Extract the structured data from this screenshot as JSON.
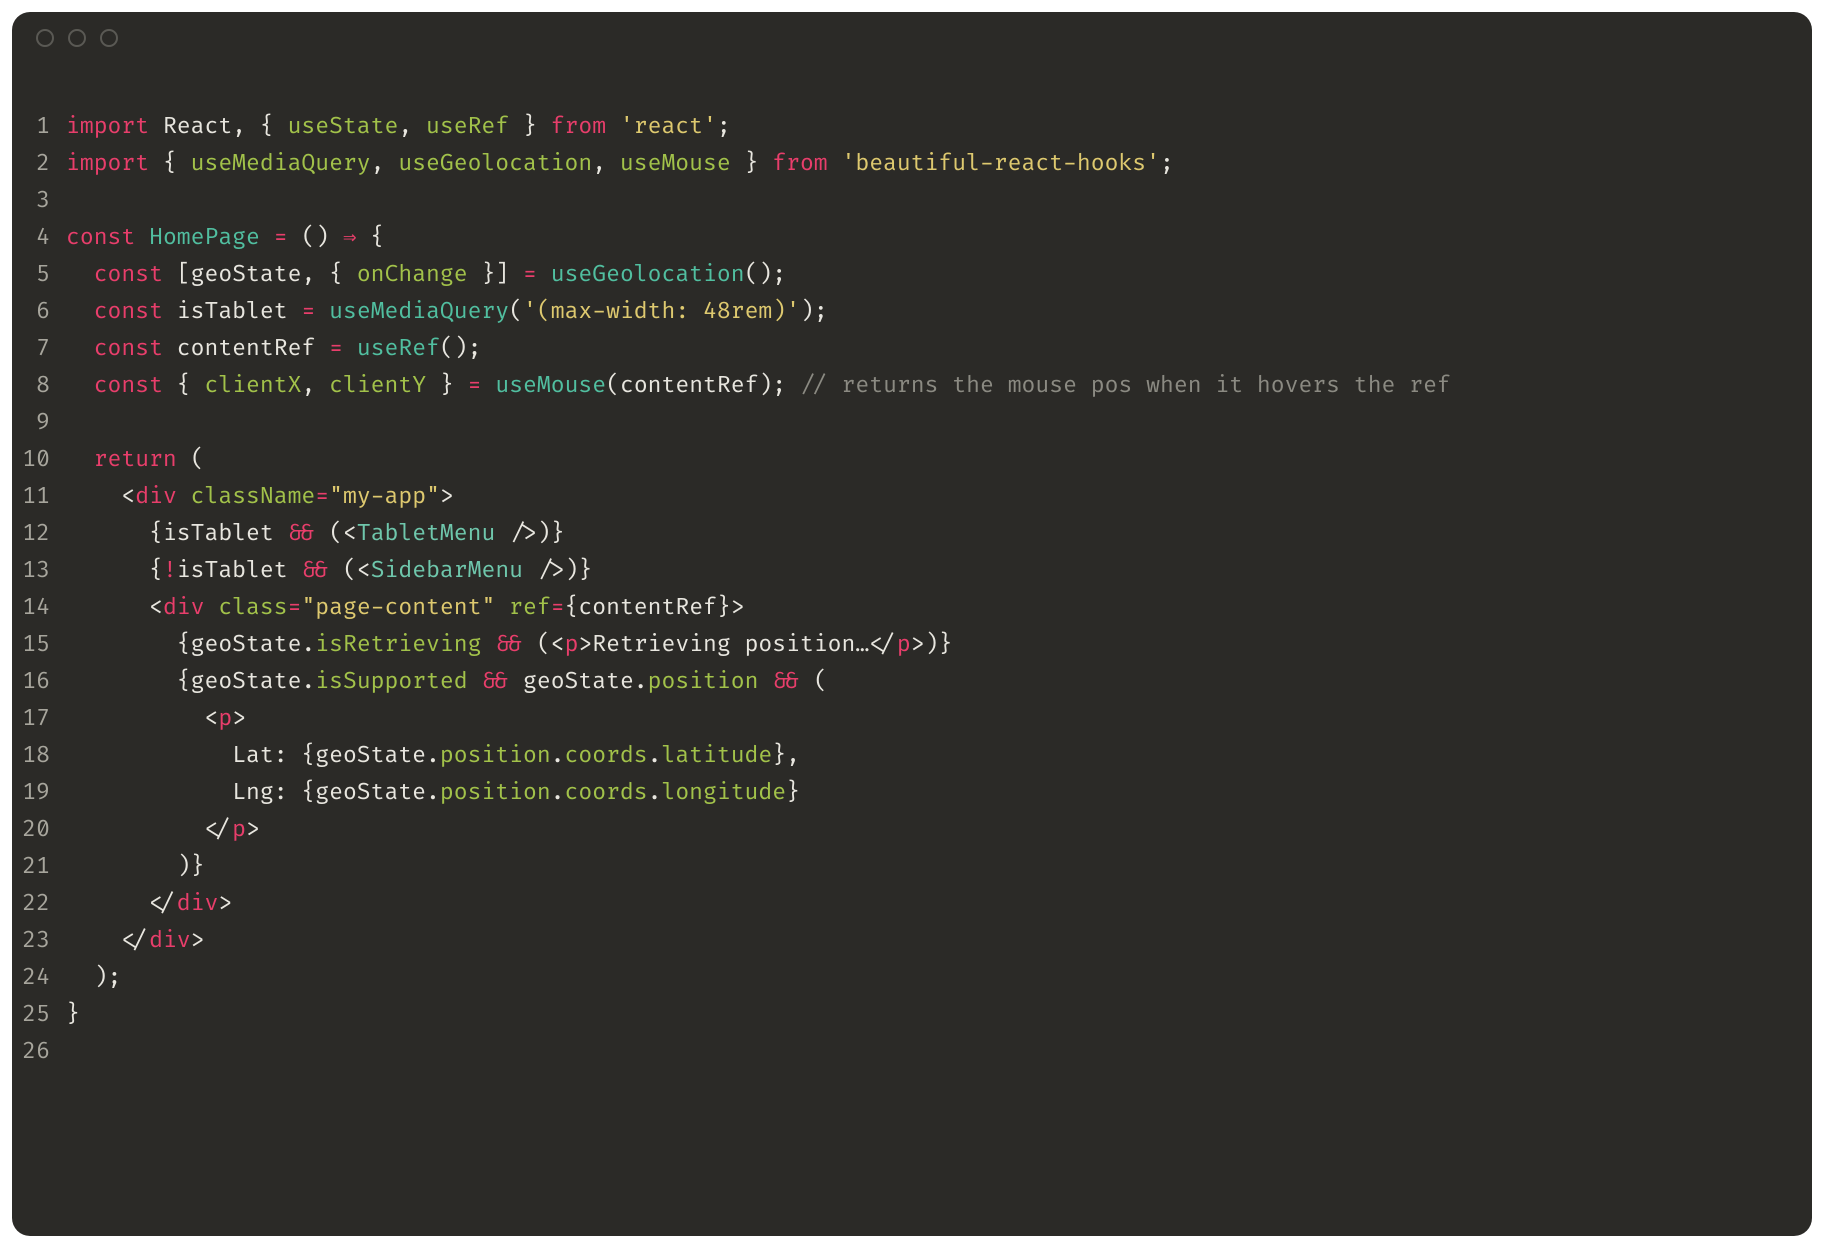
{
  "code": {
    "lines": [
      {
        "n": "1",
        "tokens": [
          {
            "c": "tk-kw",
            "t": "import"
          },
          {
            "t": " "
          },
          {
            "c": "tk-def",
            "t": "React"
          },
          {
            "c": "tk-punc",
            "t": ", { "
          },
          {
            "c": "tk-attr",
            "t": "useState"
          },
          {
            "c": "tk-punc",
            "t": ", "
          },
          {
            "c": "tk-attr",
            "t": "useRef"
          },
          {
            "c": "tk-punc",
            "t": " } "
          },
          {
            "c": "tk-kw",
            "t": "from"
          },
          {
            "t": " "
          },
          {
            "c": "tk-str",
            "t": "'react'"
          },
          {
            "c": "tk-punc",
            "t": ";"
          }
        ]
      },
      {
        "n": "2",
        "tokens": [
          {
            "c": "tk-kw",
            "t": "import"
          },
          {
            "t": " "
          },
          {
            "c": "tk-punc",
            "t": "{ "
          },
          {
            "c": "tk-attr",
            "t": "useMediaQuery"
          },
          {
            "c": "tk-punc",
            "t": ", "
          },
          {
            "c": "tk-attr",
            "t": "useGeolocation"
          },
          {
            "c": "tk-punc",
            "t": ", "
          },
          {
            "c": "tk-attr",
            "t": "useMouse"
          },
          {
            "c": "tk-punc",
            "t": " } "
          },
          {
            "c": "tk-kw",
            "t": "from"
          },
          {
            "t": " "
          },
          {
            "c": "tk-str",
            "t": "'beautiful-react-hooks'"
          },
          {
            "c": "tk-punc",
            "t": ";"
          }
        ]
      },
      {
        "n": "3",
        "tokens": []
      },
      {
        "n": "4",
        "tokens": [
          {
            "c": "tk-kw",
            "t": "const"
          },
          {
            "t": " "
          },
          {
            "c": "tk-fn",
            "t": "HomePage"
          },
          {
            "t": " "
          },
          {
            "c": "tk-kw",
            "t": "="
          },
          {
            "t": " "
          },
          {
            "c": "tk-punc",
            "t": "() "
          },
          {
            "c": "tk-kw",
            "t": "⇒"
          },
          {
            "t": " "
          },
          {
            "c": "tk-punc",
            "t": "{"
          }
        ]
      },
      {
        "n": "5",
        "tokens": [
          {
            "t": "  "
          },
          {
            "c": "tk-kw",
            "t": "const"
          },
          {
            "t": " "
          },
          {
            "c": "tk-punc",
            "t": "["
          },
          {
            "c": "tk-def",
            "t": "geoState"
          },
          {
            "c": "tk-punc",
            "t": ", { "
          },
          {
            "c": "tk-attr",
            "t": "onChange"
          },
          {
            "c": "tk-punc",
            "t": " }] "
          },
          {
            "c": "tk-kw",
            "t": "="
          },
          {
            "t": " "
          },
          {
            "c": "tk-fn",
            "t": "useGeolocation"
          },
          {
            "c": "tk-punc",
            "t": "();"
          }
        ]
      },
      {
        "n": "6",
        "tokens": [
          {
            "t": "  "
          },
          {
            "c": "tk-kw",
            "t": "const"
          },
          {
            "t": " "
          },
          {
            "c": "tk-def",
            "t": "isTablet"
          },
          {
            "t": " "
          },
          {
            "c": "tk-kw",
            "t": "="
          },
          {
            "t": " "
          },
          {
            "c": "tk-fn",
            "t": "useMediaQuery"
          },
          {
            "c": "tk-punc",
            "t": "("
          },
          {
            "c": "tk-str",
            "t": "'(max-width: 48rem)'"
          },
          {
            "c": "tk-punc",
            "t": ");"
          }
        ]
      },
      {
        "n": "7",
        "tokens": [
          {
            "t": "  "
          },
          {
            "c": "tk-kw",
            "t": "const"
          },
          {
            "t": " "
          },
          {
            "c": "tk-def",
            "t": "contentRef"
          },
          {
            "t": " "
          },
          {
            "c": "tk-kw",
            "t": "="
          },
          {
            "t": " "
          },
          {
            "c": "tk-fn",
            "t": "useRef"
          },
          {
            "c": "tk-punc",
            "t": "();"
          }
        ]
      },
      {
        "n": "8",
        "tokens": [
          {
            "t": "  "
          },
          {
            "c": "tk-kw",
            "t": "const"
          },
          {
            "t": " "
          },
          {
            "c": "tk-punc",
            "t": "{ "
          },
          {
            "c": "tk-attr",
            "t": "clientX"
          },
          {
            "c": "tk-punc",
            "t": ", "
          },
          {
            "c": "tk-attr",
            "t": "clientY"
          },
          {
            "c": "tk-punc",
            "t": " } "
          },
          {
            "c": "tk-kw",
            "t": "="
          },
          {
            "t": " "
          },
          {
            "c": "tk-fn",
            "t": "useMouse"
          },
          {
            "c": "tk-punc",
            "t": "("
          },
          {
            "c": "tk-def",
            "t": "contentRef"
          },
          {
            "c": "tk-punc",
            "t": "); "
          },
          {
            "c": "tk-cmt",
            "t": "// returns the mouse pos when it hovers the ref"
          }
        ]
      },
      {
        "n": "9",
        "tokens": []
      },
      {
        "n": "10",
        "tokens": [
          {
            "t": "  "
          },
          {
            "c": "tk-kw",
            "t": "return"
          },
          {
            "t": " "
          },
          {
            "c": "tk-punc",
            "t": "("
          }
        ]
      },
      {
        "n": "11",
        "tokens": [
          {
            "t": "    "
          },
          {
            "c": "tk-punc",
            "t": "<"
          },
          {
            "c": "tk-tag",
            "t": "div"
          },
          {
            "t": " "
          },
          {
            "c": "tk-attr",
            "t": "className"
          },
          {
            "c": "tk-kw",
            "t": "="
          },
          {
            "c": "tk-str",
            "t": "\"my-app\""
          },
          {
            "c": "tk-punc",
            "t": ">"
          }
        ]
      },
      {
        "n": "12",
        "tokens": [
          {
            "t": "      "
          },
          {
            "c": "tk-punc",
            "t": "{"
          },
          {
            "c": "tk-def",
            "t": "isTablet"
          },
          {
            "t": " "
          },
          {
            "c": "tk-kw",
            "t": "&&"
          },
          {
            "t": " "
          },
          {
            "c": "tk-punc",
            "t": "(<"
          },
          {
            "c": "tk-comp",
            "t": "TabletMenu"
          },
          {
            "t": " "
          },
          {
            "c": "tk-punc",
            "t": "/>"
          },
          {
            "c": "tk-punc",
            "t": ")}"
          }
        ]
      },
      {
        "n": "13",
        "tokens": [
          {
            "t": "      "
          },
          {
            "c": "tk-punc",
            "t": "{"
          },
          {
            "c": "tk-kw",
            "t": "!"
          },
          {
            "c": "tk-def",
            "t": "isTablet"
          },
          {
            "t": " "
          },
          {
            "c": "tk-kw",
            "t": "&&"
          },
          {
            "t": " "
          },
          {
            "c": "tk-punc",
            "t": "(<"
          },
          {
            "c": "tk-comp",
            "t": "SidebarMenu"
          },
          {
            "t": " "
          },
          {
            "c": "tk-punc",
            "t": "/>"
          },
          {
            "c": "tk-punc",
            "t": ")}"
          }
        ]
      },
      {
        "n": "14",
        "tokens": [
          {
            "t": "      "
          },
          {
            "c": "tk-punc",
            "t": "<"
          },
          {
            "c": "tk-tag",
            "t": "div"
          },
          {
            "t": " "
          },
          {
            "c": "tk-attr",
            "t": "class"
          },
          {
            "c": "tk-kw",
            "t": "="
          },
          {
            "c": "tk-str",
            "t": "\"page-content\""
          },
          {
            "t": " "
          },
          {
            "c": "tk-attr",
            "t": "ref"
          },
          {
            "c": "tk-kw",
            "t": "="
          },
          {
            "c": "tk-punc",
            "t": "{"
          },
          {
            "c": "tk-def",
            "t": "contentRef"
          },
          {
            "c": "tk-punc",
            "t": "}>"
          }
        ]
      },
      {
        "n": "15",
        "tokens": [
          {
            "t": "        "
          },
          {
            "c": "tk-punc",
            "t": "{"
          },
          {
            "c": "tk-def",
            "t": "geoState"
          },
          {
            "c": "tk-punc",
            "t": "."
          },
          {
            "c": "tk-attr",
            "t": "isRetrieving"
          },
          {
            "t": " "
          },
          {
            "c": "tk-kw",
            "t": "&&"
          },
          {
            "t": " "
          },
          {
            "c": "tk-punc",
            "t": "(<"
          },
          {
            "c": "tk-tag",
            "t": "p"
          },
          {
            "c": "tk-punc",
            "t": ">"
          },
          {
            "c": "tk-def",
            "t": "Retrieving position…"
          },
          {
            "c": "tk-punc",
            "t": "</"
          },
          {
            "c": "tk-tag",
            "t": "p"
          },
          {
            "c": "tk-punc",
            "t": ">"
          },
          {
            "c": "tk-punc",
            "t": ")}"
          }
        ]
      },
      {
        "n": "16",
        "tokens": [
          {
            "t": "        "
          },
          {
            "c": "tk-punc",
            "t": "{"
          },
          {
            "c": "tk-def",
            "t": "geoState"
          },
          {
            "c": "tk-punc",
            "t": "."
          },
          {
            "c": "tk-attr",
            "t": "isSupported"
          },
          {
            "t": " "
          },
          {
            "c": "tk-kw",
            "t": "&&"
          },
          {
            "t": " "
          },
          {
            "c": "tk-def",
            "t": "geoState"
          },
          {
            "c": "tk-punc",
            "t": "."
          },
          {
            "c": "tk-attr",
            "t": "position"
          },
          {
            "t": " "
          },
          {
            "c": "tk-kw",
            "t": "&&"
          },
          {
            "t": " "
          },
          {
            "c": "tk-punc",
            "t": "("
          }
        ]
      },
      {
        "n": "17",
        "tokens": [
          {
            "t": "          "
          },
          {
            "c": "tk-punc",
            "t": "<"
          },
          {
            "c": "tk-tag",
            "t": "p"
          },
          {
            "c": "tk-punc",
            "t": ">"
          }
        ]
      },
      {
        "n": "18",
        "tokens": [
          {
            "t": "            "
          },
          {
            "c": "tk-def",
            "t": "Lat: "
          },
          {
            "c": "tk-punc",
            "t": "{"
          },
          {
            "c": "tk-def",
            "t": "geoState"
          },
          {
            "c": "tk-punc",
            "t": "."
          },
          {
            "c": "tk-attr",
            "t": "position"
          },
          {
            "c": "tk-punc",
            "t": "."
          },
          {
            "c": "tk-attr",
            "t": "coords"
          },
          {
            "c": "tk-punc",
            "t": "."
          },
          {
            "c": "tk-attr",
            "t": "latitude"
          },
          {
            "c": "tk-punc",
            "t": "}"
          },
          {
            "c": "tk-def",
            "t": ","
          }
        ]
      },
      {
        "n": "19",
        "tokens": [
          {
            "t": "            "
          },
          {
            "c": "tk-def",
            "t": "Lng: "
          },
          {
            "c": "tk-punc",
            "t": "{"
          },
          {
            "c": "tk-def",
            "t": "geoState"
          },
          {
            "c": "tk-punc",
            "t": "."
          },
          {
            "c": "tk-attr",
            "t": "position"
          },
          {
            "c": "tk-punc",
            "t": "."
          },
          {
            "c": "tk-attr",
            "t": "coords"
          },
          {
            "c": "tk-punc",
            "t": "."
          },
          {
            "c": "tk-attr",
            "t": "longitude"
          },
          {
            "c": "tk-punc",
            "t": "}"
          }
        ]
      },
      {
        "n": "20",
        "tokens": [
          {
            "t": "          "
          },
          {
            "c": "tk-punc",
            "t": "</"
          },
          {
            "c": "tk-tag",
            "t": "p"
          },
          {
            "c": "tk-punc",
            "t": ">"
          }
        ]
      },
      {
        "n": "21",
        "tokens": [
          {
            "t": "        "
          },
          {
            "c": "tk-punc",
            "t": ")}"
          }
        ]
      },
      {
        "n": "22",
        "tokens": [
          {
            "t": "      "
          },
          {
            "c": "tk-punc",
            "t": "</"
          },
          {
            "c": "tk-tag",
            "t": "div"
          },
          {
            "c": "tk-punc",
            "t": ">"
          }
        ]
      },
      {
        "n": "23",
        "tokens": [
          {
            "t": "    "
          },
          {
            "c": "tk-punc",
            "t": "</"
          },
          {
            "c": "tk-tag",
            "t": "div"
          },
          {
            "c": "tk-punc",
            "t": ">"
          }
        ]
      },
      {
        "n": "24",
        "tokens": [
          {
            "t": "  "
          },
          {
            "c": "tk-punc",
            "t": ");"
          }
        ]
      },
      {
        "n": "25",
        "tokens": [
          {
            "c": "tk-punc",
            "t": "}"
          }
        ]
      },
      {
        "n": "26",
        "tokens": []
      }
    ]
  }
}
